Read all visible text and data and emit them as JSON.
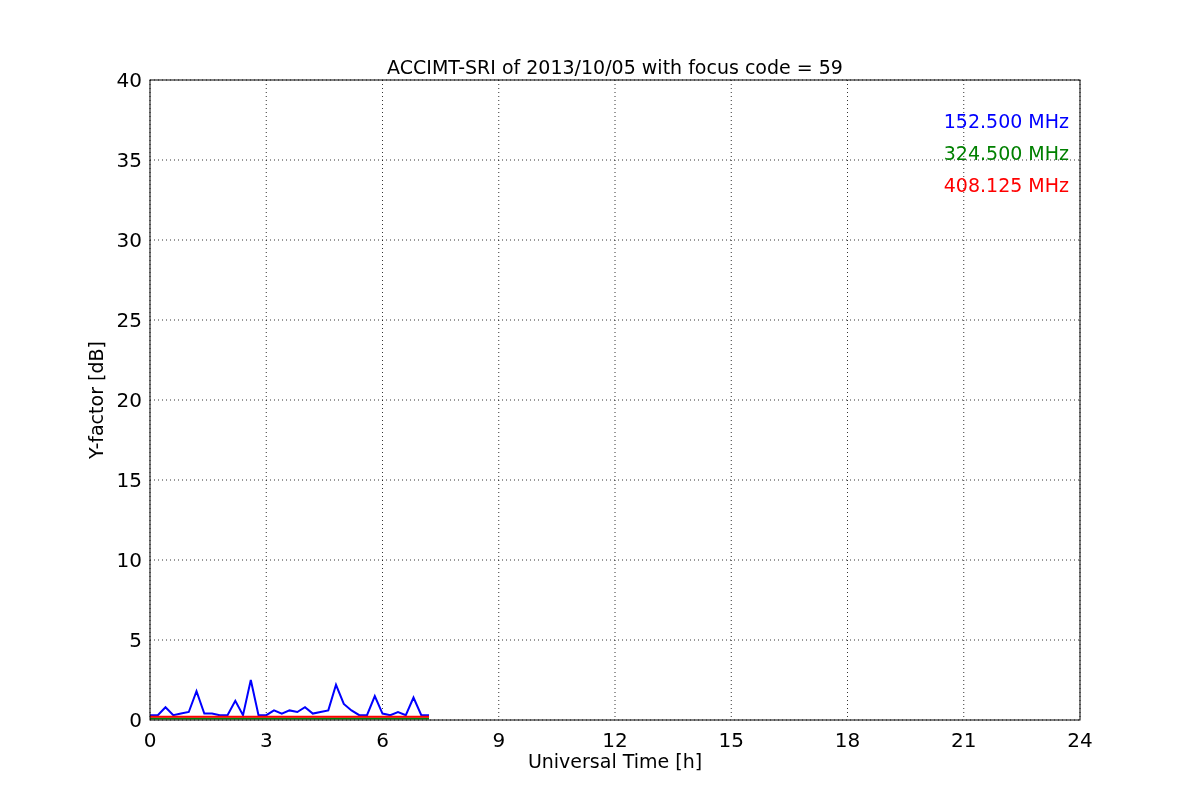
{
  "figure": {
    "chart_data": {
      "type": "line",
      "title": "ACCIMT-SRI of 2013/10/05 with focus code = 59",
      "xlabel": "Universal Time [h]",
      "ylabel": "Y-factor [dB]",
      "x": [
        0,
        0.2,
        0.4,
        0.6,
        0.8,
        1,
        1.2,
        1.4,
        1.6,
        1.8,
        2,
        2.2,
        2.4,
        2.6,
        2.8,
        3,
        3.2,
        3.4,
        3.6,
        3.8,
        4,
        4.2,
        4.4,
        4.6,
        4.8,
        5,
        5.2,
        5.4,
        5.6,
        5.8,
        6,
        6.2,
        6.4,
        6.6,
        6.8,
        7,
        7.2
      ],
      "series": [
        {
          "name": "152.500 MHz",
          "color": "#0000ff",
          "values": [
            0.3,
            0.3,
            0.8,
            0.3,
            0.4,
            0.5,
            1.8,
            0.4,
            0.4,
            0.3,
            0.3,
            1.2,
            0.3,
            2.5,
            0.3,
            0.3,
            0.6,
            0.4,
            0.6,
            0.5,
            0.8,
            0.4,
            0.5,
            0.6,
            2.2,
            1.0,
            0.6,
            0.3,
            0.3,
            1.5,
            0.4,
            0.3,
            0.5,
            0.3,
            1.4,
            0.3,
            0.3
          ]
        },
        {
          "name": "324.500 MHz",
          "color": "#008000",
          "values": [
            0.1,
            0.1,
            0.1,
            0.1,
            0.1,
            0.1,
            0.1,
            0.1,
            0.1,
            0.1,
            0.1,
            0.1,
            0.1,
            0.1,
            0.1,
            0.1,
            0.1,
            0.1,
            0.1,
            0.1,
            0.1,
            0.1,
            0.1,
            0.1,
            0.1,
            0.1,
            0.1,
            0.1,
            0.1,
            0.1,
            0.1,
            0.1,
            0.1,
            0.1,
            0.1,
            0.1,
            0.1
          ]
        },
        {
          "name": "408.125 MHz",
          "color": "#ff0000",
          "values": [
            0.2,
            0.2,
            0.2,
            0.2,
            0.2,
            0.2,
            0.2,
            0.2,
            0.2,
            0.2,
            0.2,
            0.2,
            0.2,
            0.2,
            0.2,
            0.2,
            0.2,
            0.2,
            0.2,
            0.2,
            0.2,
            0.2,
            0.2,
            0.2,
            0.2,
            0.2,
            0.2,
            0.2,
            0.2,
            0.2,
            0.2,
            0.2,
            0.2,
            0.2,
            0.2,
            0.2,
            0.2
          ]
        }
      ],
      "grid": true,
      "xlim": [
        0,
        24
      ],
      "ylim": [
        0,
        40
      ],
      "xticks": [
        0,
        3,
        6,
        9,
        12,
        15,
        18,
        21,
        24
      ],
      "yticks": [
        0,
        5,
        10,
        15,
        20,
        25,
        30,
        35,
        40
      ]
    }
  }
}
